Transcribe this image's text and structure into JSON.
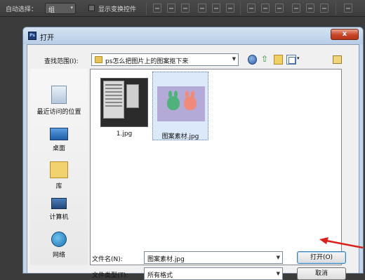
{
  "options_bar": {
    "auto_select_label": "自动选择：",
    "auto_select_value": "组",
    "show_transform_label": "显示变换控件"
  },
  "dialog": {
    "title": "打开",
    "close_glyph": "x",
    "look_in_label": "查找范围(I):",
    "look_in_value": "ps怎么把图片上的图案抠下来",
    "places": [
      "最近访问的位置",
      "桌面",
      "库",
      "计算机",
      "网络"
    ],
    "files": [
      {
        "name": "1.jpg",
        "selected": false
      },
      {
        "name": "图案素材.jpg",
        "selected": true
      }
    ],
    "filename_label": "文件名(N):",
    "filename_value": "图案素材.jpg",
    "filetype_label": "文件类型(T):",
    "filetype_value": "所有格式",
    "open_button": "打开(O)",
    "cancel_button": "取消"
  },
  "icons": {
    "app": "photoshop-icon",
    "back": "back-icon",
    "up": "up-folder-icon",
    "new_folder": "new-folder-icon",
    "views": "views-menu-icon"
  },
  "colors": {
    "annotation_arrow": "#d9201a",
    "ps_background": "#3b3b3b"
  }
}
